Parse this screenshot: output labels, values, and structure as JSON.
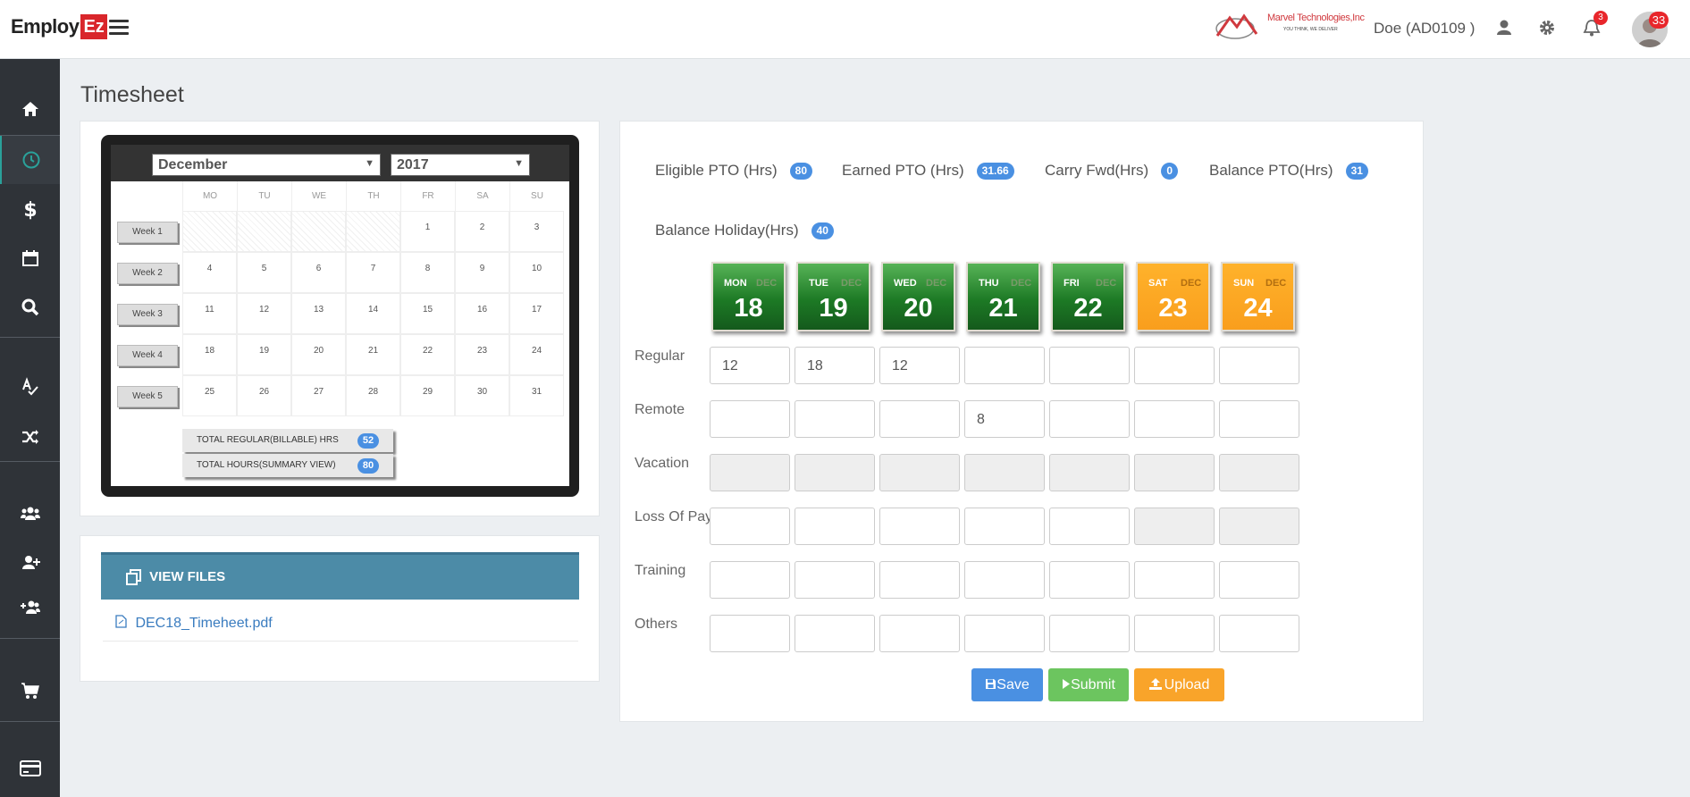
{
  "header": {
    "logo": {
      "part1": "Employ",
      "part2": "Ez"
    },
    "company": {
      "name": "Marvel Technologies,Inc",
      "tagline": "YOU THINK, WE DELIVER"
    },
    "user": "Doe (AD0109 )",
    "notifications_count": "3",
    "avatar_count": "33",
    "icons": [
      "user-icon",
      "gear-icon",
      "bell-icon"
    ]
  },
  "sidebar": {
    "items": [
      "home-icon",
      "clock-icon",
      "dollar-icon",
      "calendar-icon",
      "search-icon",
      "spellcheck-icon",
      "shuffle-icon",
      "users-icon",
      "user-plus-icon",
      "user-group-plus-icon",
      "cart-icon",
      "credit-card-icon"
    ],
    "active": "clock-icon"
  },
  "page": {
    "title": "Timesheet"
  },
  "calendar": {
    "month": "December",
    "year": "2017",
    "weekday_headers": [
      "MO",
      "TU",
      "WE",
      "TH",
      "FR",
      "SA",
      "SU"
    ],
    "weeks": [
      {
        "label": "Week 1",
        "days": [
          "",
          "",
          "",
          "",
          "1",
          "2",
          "3"
        ]
      },
      {
        "label": "Week 2",
        "days": [
          "4",
          "5",
          "6",
          "7",
          "8",
          "9",
          "10"
        ]
      },
      {
        "label": "Week 3",
        "days": [
          "11",
          "12",
          "13",
          "14",
          "15",
          "16",
          "17"
        ]
      },
      {
        "label": "Week 4",
        "days": [
          "18",
          "19",
          "20",
          "21",
          "22",
          "23",
          "24"
        ]
      },
      {
        "label": "Week 5",
        "days": [
          "25",
          "26",
          "27",
          "28",
          "29",
          "30",
          "31"
        ]
      }
    ],
    "totals": [
      {
        "label": "TOTAL REGULAR(BILLABLE) HRS",
        "value": "52"
      },
      {
        "label": "TOTAL HOURS(SUMMARY VIEW)",
        "value": "80"
      }
    ]
  },
  "files": {
    "header": "VIEW FILES",
    "items": [
      "DEC18_Timeheet.pdf"
    ]
  },
  "pto": [
    {
      "label": "Eligible PTO (Hrs)",
      "value": "80"
    },
    {
      "label": "Earned PTO (Hrs)",
      "value": "31.66"
    },
    {
      "label": "Carry Fwd(Hrs)",
      "value": "0"
    },
    {
      "label": "Balance PTO(Hrs)",
      "value": "31"
    },
    {
      "label": "Balance Holiday(Hrs)",
      "value": "40"
    }
  ],
  "days": [
    {
      "dow": "MON",
      "mon": "DEC",
      "day": "18",
      "weekend": false
    },
    {
      "dow": "TUE",
      "mon": "DEC",
      "day": "19",
      "weekend": false
    },
    {
      "dow": "WED",
      "mon": "DEC",
      "day": "20",
      "weekend": false
    },
    {
      "dow": "THU",
      "mon": "DEC",
      "day": "21",
      "weekend": false
    },
    {
      "dow": "FRI",
      "mon": "DEC",
      "day": "22",
      "weekend": false
    },
    {
      "dow": "SAT",
      "mon": "DEC",
      "day": "23",
      "weekend": true
    },
    {
      "dow": "SUN",
      "mon": "DEC",
      "day": "24",
      "weekend": true
    }
  ],
  "rows": [
    {
      "label": "Regular",
      "values": [
        "12",
        "18",
        "12",
        "",
        "",
        "",
        ""
      ],
      "disabled": [
        false,
        false,
        false,
        false,
        false,
        false,
        false
      ]
    },
    {
      "label": "Remote",
      "values": [
        "",
        "",
        "",
        "8",
        "",
        "",
        ""
      ],
      "disabled": [
        false,
        false,
        false,
        false,
        false,
        false,
        false
      ]
    },
    {
      "label": "Vacation",
      "values": [
        "",
        "",
        "",
        "",
        "",
        "",
        ""
      ],
      "disabled": [
        true,
        true,
        true,
        true,
        true,
        true,
        true
      ]
    },
    {
      "label": "Loss Of Pay",
      "values": [
        "",
        "",
        "",
        "",
        "",
        "",
        ""
      ],
      "disabled": [
        false,
        false,
        false,
        false,
        false,
        true,
        true
      ]
    },
    {
      "label": "Training",
      "values": [
        "",
        "",
        "",
        "",
        "",
        "",
        ""
      ],
      "disabled": [
        false,
        false,
        false,
        false,
        false,
        false,
        false
      ]
    },
    {
      "label": "Others",
      "values": [
        "",
        "",
        "",
        "",
        "",
        "",
        ""
      ],
      "disabled": [
        false,
        false,
        false,
        false,
        false,
        false,
        false
      ]
    }
  ],
  "actions": {
    "save": "Save",
    "submit": "Submit",
    "upload": "Upload"
  },
  "colors": {
    "primary": "#4a90e2",
    "save": "#4a90e2",
    "submit": "#6cc55f",
    "upload": "#f9a42a",
    "sidebar": "#2f3338",
    "file_header": "#4c8ba7",
    "tile_green": "#1d7a25",
    "tile_orange": "#f99e1d"
  }
}
